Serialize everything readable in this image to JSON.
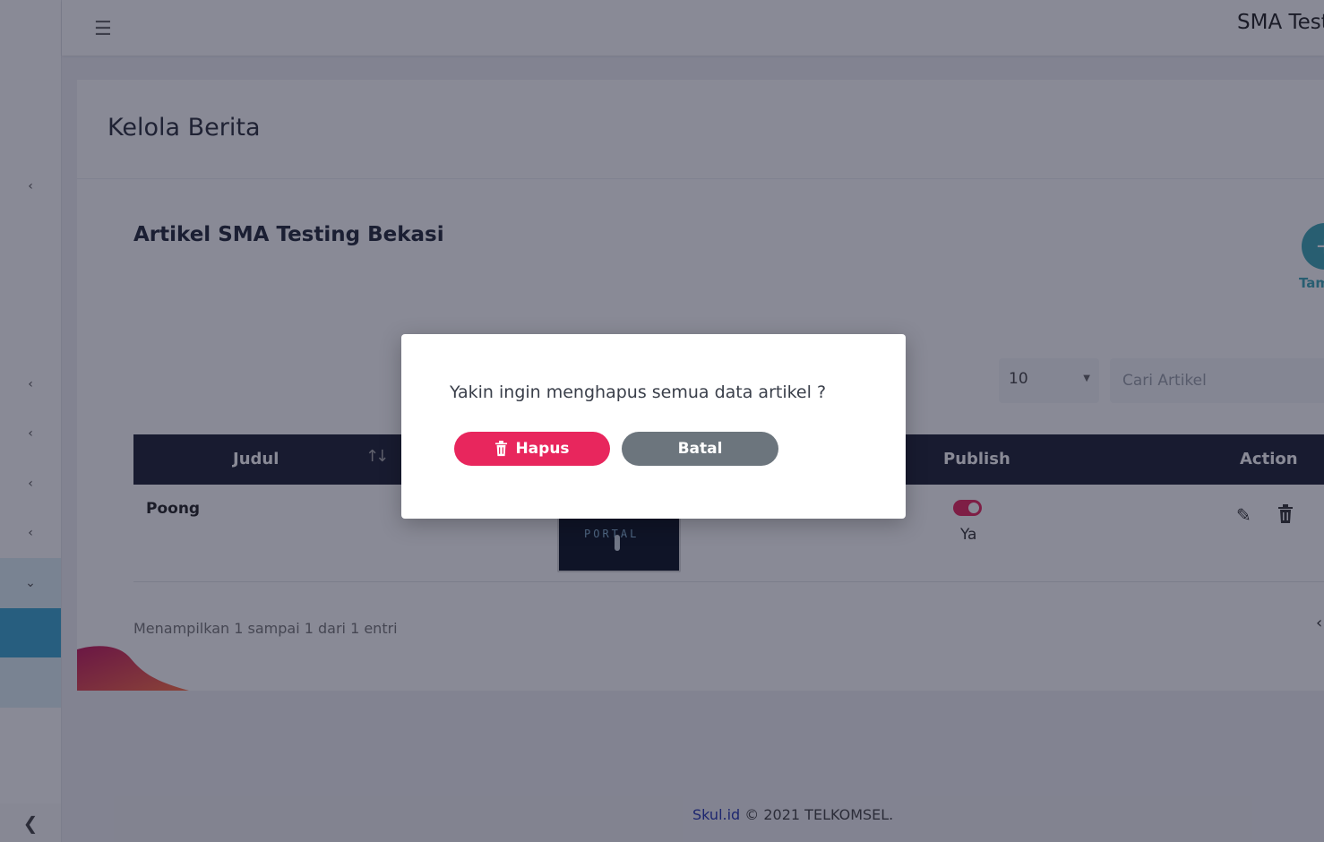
{
  "topbar": {
    "menu_icon": "hamburger-icon",
    "school_name": "SMA Test"
  },
  "page": {
    "title": "Kelola Berita",
    "section_title": "Artikel SMA Testing Bekasi"
  },
  "add_button": {
    "label": "Tam",
    "icon": "plus-icon"
  },
  "table_controls": {
    "per_page": "10",
    "search_placeholder": "Cari Artikel"
  },
  "table": {
    "headers": {
      "title": "Judul",
      "publish": "Publish",
      "action": "Action"
    },
    "rows": [
      {
        "title": "Poong",
        "thumb_text": "PORTAL",
        "publish_label": "Ya",
        "published": true
      }
    ],
    "info": "Menampilkan 1 sampai 1 dari 1 entri"
  },
  "footer": {
    "brand": "Skul.id",
    "text": " © 2021 TELKOMSEL."
  },
  "modal": {
    "message": "Yakin ingin menghapus semua data artikel ?",
    "confirm_label": "Hapus",
    "cancel_label": "Batal"
  },
  "colors": {
    "danger": "#e8265d",
    "secondary": "#6c757d",
    "accent": "#3ca7b5",
    "table_header": "#1d2033"
  }
}
